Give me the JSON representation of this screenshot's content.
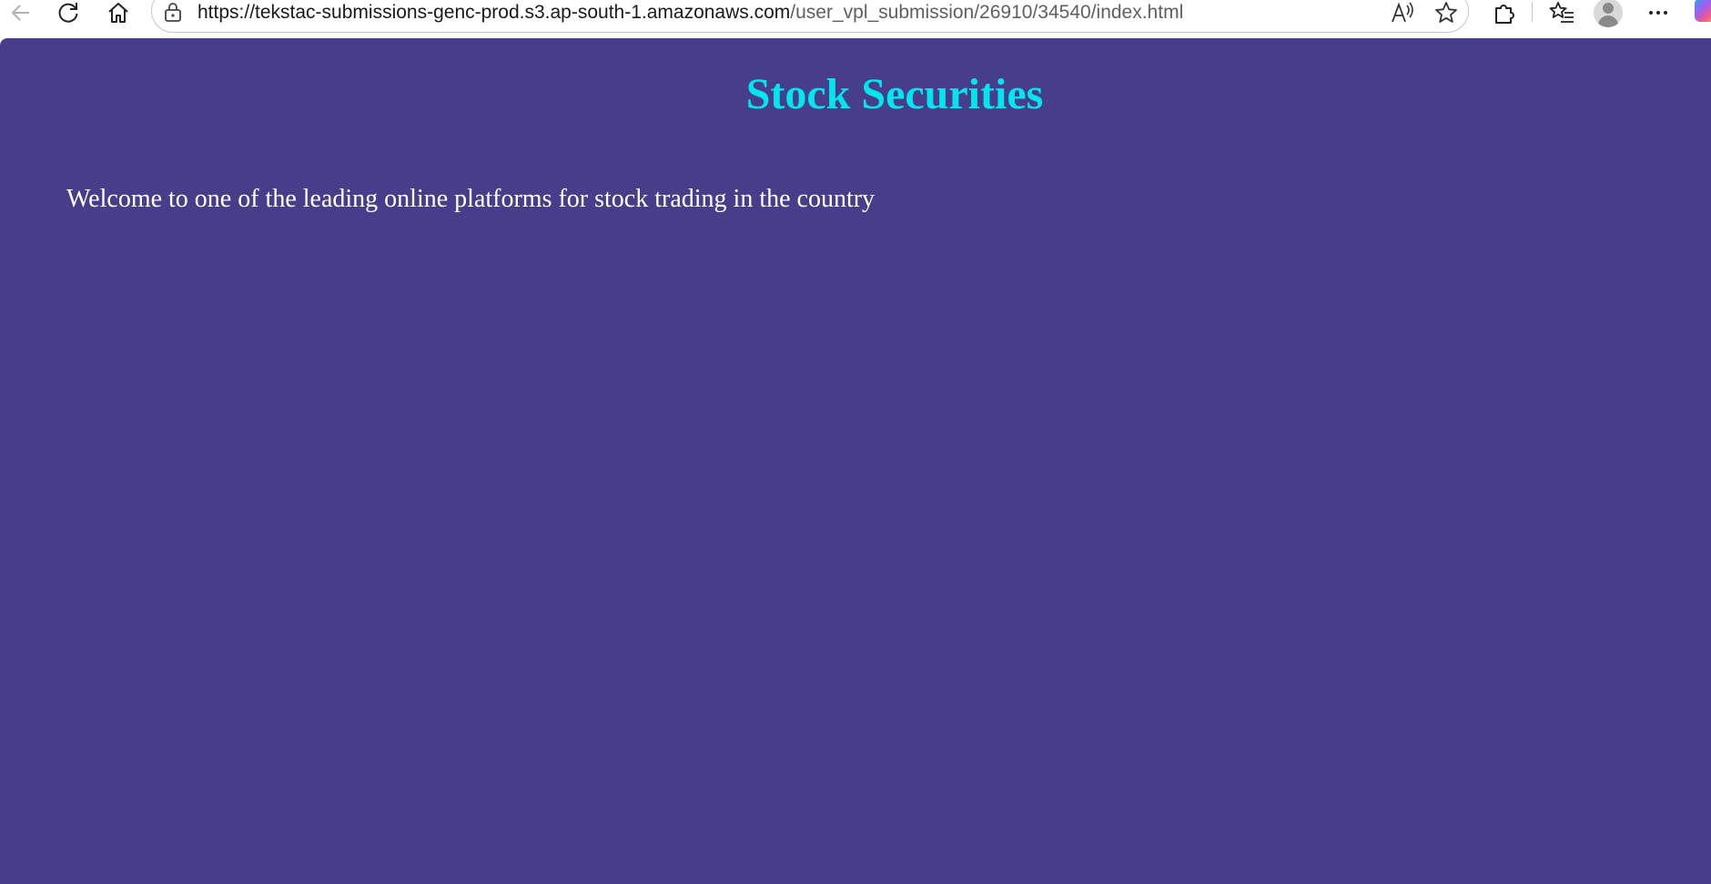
{
  "browser": {
    "address_bar": {
      "url_host": "https://tekstac-submissions-genc-prod.s3.ap-south-1.amazonaws.com",
      "url_path": "/user_vpl_submission/26910/34540/index.html"
    },
    "icons": {
      "back": "back-arrow-icon",
      "refresh": "refresh-icon",
      "home": "home-icon",
      "site_info": "lock-icon",
      "read_aloud": "read-aloud-icon",
      "favorite": "star-icon",
      "extensions": "puzzle-icon",
      "favorites_list": "favorites-list-icon",
      "profile": "avatar",
      "more": "more-dots-icon",
      "copilot": "copilot-icon"
    }
  },
  "page": {
    "background_color": "#483d8b",
    "title": "Stock Securities",
    "title_color": "#00e5ee",
    "welcome_text": "Welcome to one of the leading online platforms for stock trading in the country",
    "welcome_color": "#ffffff"
  }
}
